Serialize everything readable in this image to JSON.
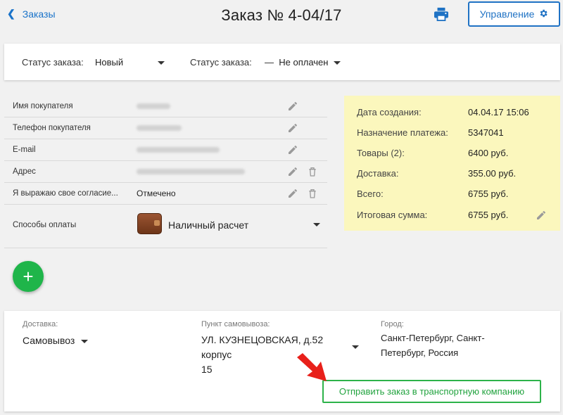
{
  "header": {
    "back_label": "Заказы",
    "title": "Заказ № 4-04/17",
    "print_icon": "printer-icon",
    "manage_label": "Управление",
    "manage_icon": "gear-icon",
    "accent_color": "#1f72c4"
  },
  "status_bar": {
    "order_status_label": "Статус заказа:",
    "order_status_value": "Новый",
    "payment_status_label": "Статус заказа:",
    "payment_status_prefix": "—",
    "payment_status_value": "Не оплачен"
  },
  "customer_fields": [
    {
      "label": "Имя покупателя",
      "value": "",
      "obscured": true,
      "editable": true,
      "deletable": false
    },
    {
      "label": "Телефон покупателя",
      "value": "",
      "obscured": true,
      "editable": true,
      "deletable": false
    },
    {
      "label": "E-mail",
      "value": "",
      "obscured": true,
      "editable": true,
      "deletable": false
    },
    {
      "label": "Адрес",
      "value": "",
      "obscured": true,
      "editable": true,
      "deletable": true
    },
    {
      "label": "Я выражаю свое согласие...",
      "value": "Отмечено",
      "obscured": false,
      "editable": true,
      "deletable": true
    }
  ],
  "payment": {
    "label": "Способы оплаты",
    "value": "Наличный расчет",
    "icon": "wallet-icon"
  },
  "summary": {
    "background": "#fbf7bd",
    "rows": [
      {
        "label": "Дата создания:",
        "value": "04.04.17 15:06"
      },
      {
        "label": "Назначение платежа:",
        "value": "5347041"
      },
      {
        "label": "Товары (2):",
        "value": "6400 руб."
      },
      {
        "label": "Доставка:",
        "value": "355.00 руб."
      },
      {
        "label": "Всего:",
        "value": "6755 руб."
      },
      {
        "label": "Итоговая сумма:",
        "value": "6755 руб."
      }
    ]
  },
  "delivery": {
    "delivery_label": "Доставка:",
    "delivery_value": "Самовывоз",
    "pickup_label": "Пункт самовывоза:",
    "pickup_line1": "УЛ. КУЗНЕЦОВСКАЯ, д.52 корпус",
    "pickup_line2": "15",
    "city_label": "Город:",
    "city_line1": "Санкт-Петербург, Санкт-",
    "city_line2": "Петербург, Россия",
    "send_button": "Отправить заказ в транспортную компанию",
    "send_color": "#2db34a"
  },
  "add_button_icon": "plus-icon"
}
